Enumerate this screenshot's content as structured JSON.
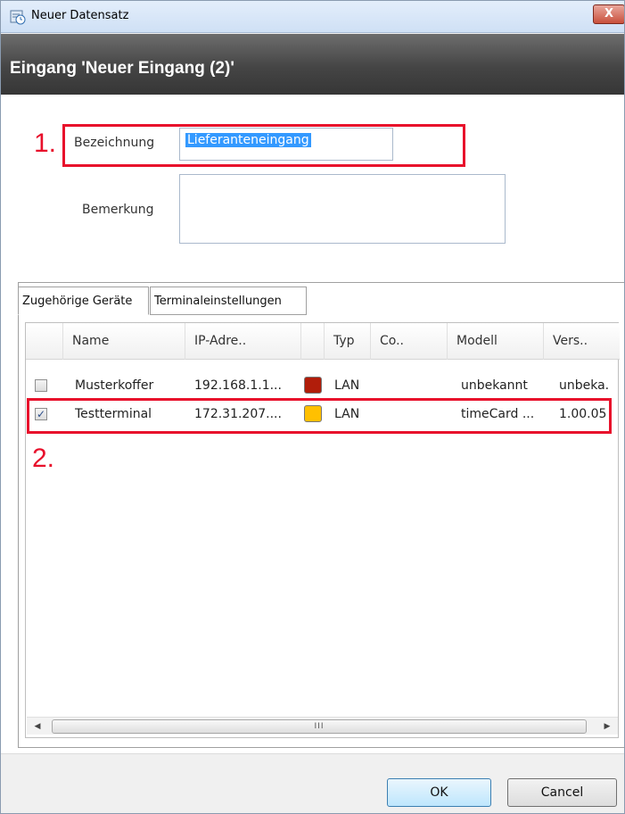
{
  "window": {
    "title": "Neuer Datensatz",
    "close_label": "X"
  },
  "header": {
    "heading": "Eingang 'Neuer Eingang (2)'"
  },
  "form": {
    "bezeichnung_label": "Bezeichnung",
    "bezeichnung_value": "Lieferanteneingang",
    "bemerkung_label": "Bemerkung",
    "bemerkung_value": ""
  },
  "annotations": {
    "one": "1.",
    "two": "2."
  },
  "tabs": [
    {
      "label": "Zugehörige Geräte",
      "active": true
    },
    {
      "label": "Terminaleinstellungen",
      "active": false
    }
  ],
  "grid": {
    "columns": [
      "Name",
      "IP-Adre..",
      "Typ",
      "Co..",
      "Modell",
      "Vers.."
    ],
    "rows": [
      {
        "checked": false,
        "name": "Musterkoffer",
        "ip": "192.168.1.1...",
        "status_color": "#b11d0a",
        "typ": "LAN",
        "co": "",
        "modell": "unbekannt",
        "version": "unbeka."
      },
      {
        "checked": true,
        "name": "Testterminal",
        "ip": "172.31.207....",
        "status_color": "#ffc000",
        "typ": "LAN",
        "co": "",
        "modell": "timeCard ...",
        "version": "1.00.05"
      }
    ],
    "scroll_grip": "III"
  },
  "buttons": {
    "ok": "OK",
    "cancel": "Cancel"
  },
  "colors": {
    "annotation_red": "#e8102b",
    "header_dark": "#454545",
    "selection_blue": "#3399ff"
  }
}
